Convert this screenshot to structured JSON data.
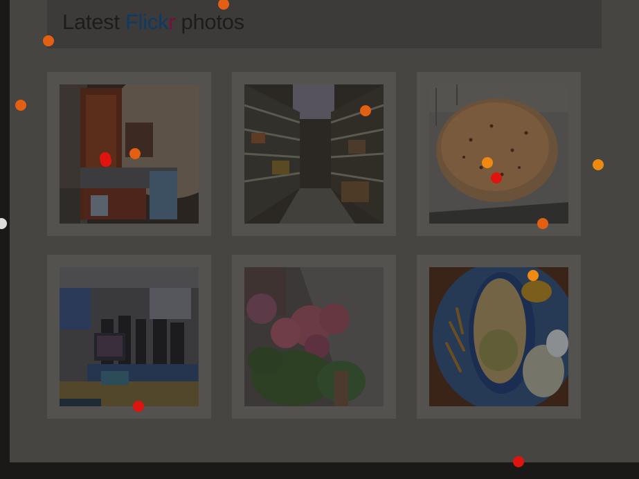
{
  "widget": {
    "title_prefix": "Latest ",
    "title_brand_1": "Flick",
    "title_brand_2": "r",
    "title_suffix": " photos"
  },
  "photos": [
    {
      "subject": "wooden-cabinet-photo"
    },
    {
      "subject": "grocery-aisle-photo"
    },
    {
      "subject": "flatbread-photo"
    },
    {
      "subject": "computer-lab-photo"
    },
    {
      "subject": "flowers-photo"
    },
    {
      "subject": "food-plate-photo"
    }
  ],
  "colors": {
    "flickr_blue": "#0063dc",
    "flickr_pink": "#ff0084",
    "marker_red": "#e0140e",
    "marker_orange": "#e35f14",
    "marker_amber": "#ee8a12",
    "marker_white": "#dddddd"
  }
}
